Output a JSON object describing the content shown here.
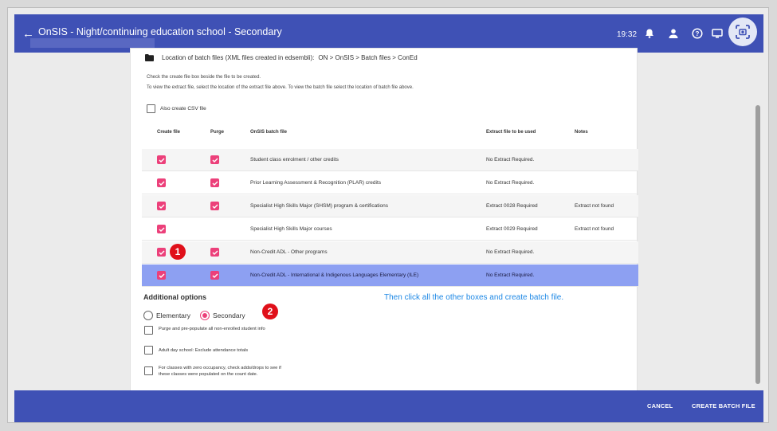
{
  "topbar": {
    "title": "OnSIS - Night/continuing education school - Secondary",
    "time": "19:32",
    "icons": [
      "back-arrow-icon",
      "bell-icon",
      "person-icon",
      "help-icon",
      "display-icon",
      "screen-capture-icon"
    ]
  },
  "location": {
    "label": "Location of batch files (XML files created in edsembli):",
    "path": "ON > OnSIS > Batch files > ConEd"
  },
  "hints": {
    "line1": "Check the create file box beside the file to be created.",
    "line2": "To view the extract file, select the location of the extract file above. To view the batch file select the location of batch file above."
  },
  "csv_option": {
    "label": "Also create CSV file"
  },
  "table": {
    "headers": [
      "Create file",
      "Purge",
      "OnSIS batch file",
      "Extract file to be used",
      "Notes"
    ],
    "rows": [
      {
        "create": true,
        "purge": true,
        "file": "Student class enrolment / other credits",
        "extract": "No Extract Required.",
        "notes": ""
      },
      {
        "create": true,
        "purge": true,
        "file": "Prior Learning Assessment & Recognition (PLAR) credits",
        "extract": "No Extract Required.",
        "notes": ""
      },
      {
        "create": true,
        "purge": true,
        "file": "Specialist High Skills Major (SHSM) program & certifications",
        "extract": "Extract 0028 Required",
        "notes": "Extract not found"
      },
      {
        "create": true,
        "purge": false,
        "file": "Specialist High Skills Major courses",
        "extract": "Extract 0029 Required",
        "notes": "Extract not found"
      },
      {
        "create": true,
        "purge": true,
        "file": "Non-Credit ADL - Other programs",
        "extract": "No Extract Required.",
        "notes": ""
      },
      {
        "create": true,
        "purge": true,
        "file": "Non-Credit ADL - International & Indigenous Languages Elementary (ILE)",
        "extract": "No Extract Required.",
        "notes": ""
      }
    ]
  },
  "badges": {
    "one": "1",
    "two": "2"
  },
  "annotation": "Then click all the other boxes and create batch file.",
  "additional_options": {
    "title": "Additional options",
    "radio_elementary": "Elementary",
    "radio_secondary": "Secondary",
    "selected": "Secondary",
    "opt1": "Purge and pre-populate all non-enrolled student info",
    "opt2": "Adult day school: Exclude attendance totals",
    "opt3_line1": "For classes with zero occupancy, check adds/drops to see if",
    "opt3_line2": "these classes were populated on the count date."
  },
  "footer": {
    "cancel": "CANCEL",
    "create": "CREATE BATCH FILE"
  },
  "colors": {
    "primary": "#3f51b5",
    "accent": "#ec407a",
    "row_highlight": "#8da0f2",
    "badge": "#e0101a",
    "annotation": "#1e88e5"
  }
}
